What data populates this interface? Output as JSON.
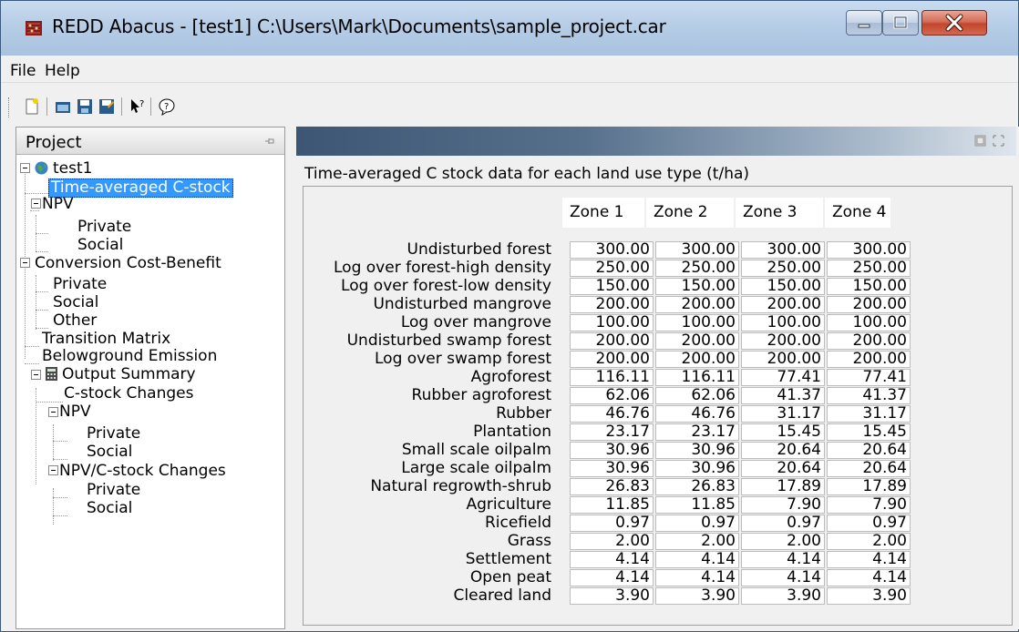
{
  "window": {
    "title": "REDD Abacus - [test1] C:\\Users\\Mark\\Documents\\sample_project.car"
  },
  "menu": {
    "file": "File",
    "help": "Help"
  },
  "toolbar": {
    "icons": [
      "new-icon",
      "open-icon",
      "save-icon",
      "save-as-icon",
      "whats-this-icon",
      "about-icon"
    ]
  },
  "project_panel": {
    "title": "Project",
    "tree": {
      "root": "test1",
      "time_averaged": "Time-averaged C-stock",
      "npv": "NPV",
      "npv_private": "Private",
      "npv_social": "Social",
      "conversion": "Conversion Cost-Benefit",
      "conv_private": "Private",
      "conv_social": "Social",
      "conv_other": "Other",
      "transition": "Transition Matrix",
      "belowground": "Belowground Emission",
      "output": "Output Summary",
      "cstock_changes": "C-stock Changes",
      "out_npv": "NPV",
      "out_npv_private": "Private",
      "out_npv_social": "Social",
      "npv_cstock": "NPV/C-stock Changes",
      "npv_cstock_private": "Private",
      "npv_cstock_social": "Social"
    }
  },
  "content": {
    "caption": "Time-averaged C stock data for each land use type (t/ha)",
    "columns": [
      "Zone 1",
      "Zone 2",
      "Zone 3",
      "Zone 4"
    ],
    "rows": [
      {
        "label": "Undisturbed forest",
        "values": [
          "300.00",
          "300.00",
          "300.00",
          "300.00"
        ]
      },
      {
        "label": "Log over forest-high density",
        "values": [
          "250.00",
          "250.00",
          "250.00",
          "250.00"
        ]
      },
      {
        "label": "Log over forest-low density",
        "values": [
          "150.00",
          "150.00",
          "150.00",
          "150.00"
        ]
      },
      {
        "label": "Undisturbed mangrove",
        "values": [
          "200.00",
          "200.00",
          "200.00",
          "200.00"
        ]
      },
      {
        "label": "Log over mangrove",
        "values": [
          "100.00",
          "100.00",
          "100.00",
          "100.00"
        ]
      },
      {
        "label": "Undisturbed swamp forest",
        "values": [
          "200.00",
          "200.00",
          "200.00",
          "200.00"
        ]
      },
      {
        "label": "Log over swamp forest",
        "values": [
          "200.00",
          "200.00",
          "200.00",
          "200.00"
        ]
      },
      {
        "label": "Agroforest",
        "values": [
          "116.11",
          "116.11",
          "77.41",
          "77.41"
        ]
      },
      {
        "label": "Rubber agroforest",
        "values": [
          "62.06",
          "62.06",
          "41.37",
          "41.37"
        ]
      },
      {
        "label": "Rubber",
        "values": [
          "46.76",
          "46.76",
          "31.17",
          "31.17"
        ]
      },
      {
        "label": "Plantation",
        "values": [
          "23.17",
          "23.17",
          "15.45",
          "15.45"
        ]
      },
      {
        "label": "Small scale oilpalm",
        "values": [
          "30.96",
          "30.96",
          "20.64",
          "20.64"
        ]
      },
      {
        "label": "Large scale oilpalm",
        "values": [
          "30.96",
          "30.96",
          "20.64",
          "20.64"
        ]
      },
      {
        "label": "Natural regrowth-shrub",
        "values": [
          "26.83",
          "26.83",
          "17.89",
          "17.89"
        ]
      },
      {
        "label": "Agriculture",
        "values": [
          "11.85",
          "11.85",
          "7.90",
          "7.90"
        ]
      },
      {
        "label": "Ricefield",
        "values": [
          "0.97",
          "0.97",
          "0.97",
          "0.97"
        ]
      },
      {
        "label": "Grass",
        "values": [
          "2.00",
          "2.00",
          "2.00",
          "2.00"
        ]
      },
      {
        "label": "Settlement",
        "values": [
          "4.14",
          "4.14",
          "4.14",
          "4.14"
        ]
      },
      {
        "label": "Open peat",
        "values": [
          "4.14",
          "4.14",
          "4.14",
          "4.14"
        ]
      },
      {
        "label": "Cleared land",
        "values": [
          "3.90",
          "3.90",
          "3.90",
          "3.90"
        ]
      }
    ]
  },
  "colors": {
    "selection": "#3399ff",
    "close_button": "#c2462d",
    "doc_header": "#3d5673"
  }
}
